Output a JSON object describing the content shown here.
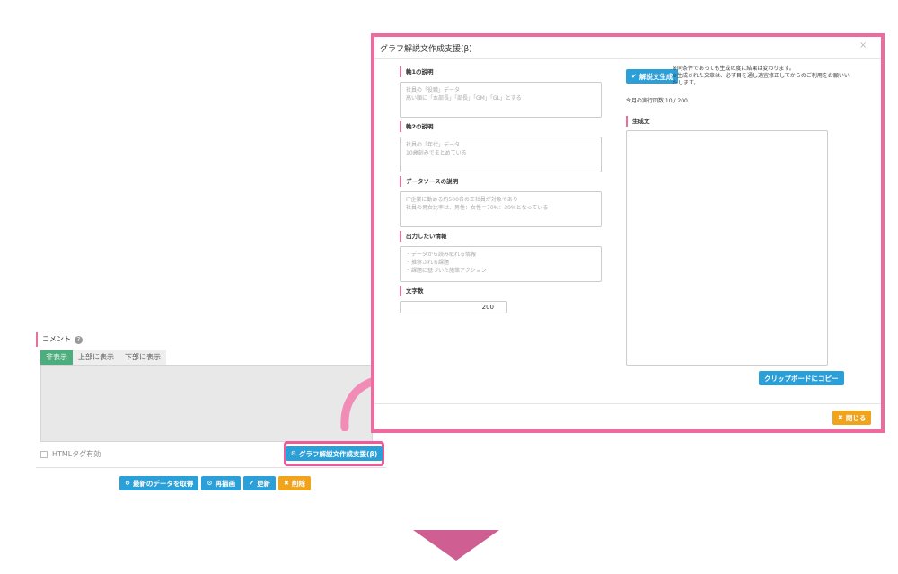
{
  "comment": {
    "label": "コメント",
    "tabs": [
      "非表示",
      "上部に表示",
      "下部に表示"
    ],
    "html_checkbox_label": "HTMLタグ有効",
    "graph_button_label": "グラフ解説文作成支援(β)"
  },
  "actions": {
    "refresh_label": "最新のデータを取得",
    "redraw_label": "再描画",
    "update_label": "更新",
    "delete_label": "削除"
  },
  "dialog": {
    "title": "グラフ解説文作成支援(β)",
    "close_x": "×",
    "fields": [
      {
        "label": "軸1の説明",
        "placeholder": "社員の「役職」データ\n高い順に「本部長」「部長」「GM」「GL」とする"
      },
      {
        "label": "軸2の説明",
        "placeholder": "社員の「年代」データ\n10歳刻みでまとめている"
      },
      {
        "label": "データソースの説明",
        "placeholder": "IT企業に勤める約500名の正社員が対象であり\n社員の男女比率は、男性：女性＝70%：30%となっている"
      },
      {
        "label": "出力したい情報",
        "placeholder": "・データから読み取れる情報\n・推察される課題\n・課題に基づいた施策アクション"
      }
    ],
    "char_count_label": "文字数",
    "char_count_value": "200",
    "generate_button": "解説文生成",
    "notes": "※同条件であっても生成の度に結果は変わります。\n※生成された文章は、必ず目を通し適宜修正してからのご利用をお願いいたします。",
    "monthly_count": "今月の実行回数 10 / 200",
    "output_label": "生成文",
    "copy_button": "クリップボードにコピー",
    "close_button": "閉じる"
  },
  "colors": {
    "accent_pink": "#ee6ba0",
    "button_blue": "#2a9fd8",
    "button_orange": "#f0a31c",
    "tab_green": "#4cae7d"
  },
  "icons": {
    "help": "question-circle-icon",
    "gear": "gear-icon",
    "refresh": "refresh-icon",
    "check": "check-icon",
    "close": "close-icon"
  }
}
